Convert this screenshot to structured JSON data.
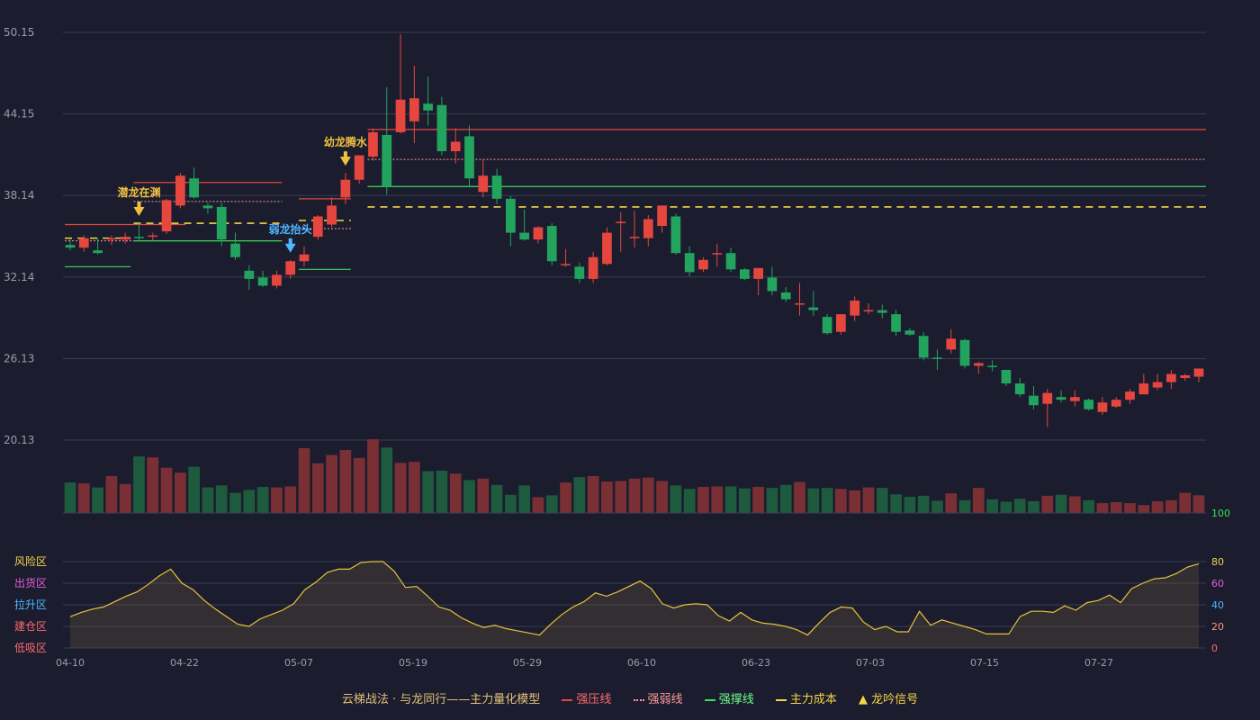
{
  "colors": {
    "background": "#1b1c2e",
    "up": "#e5473f",
    "down": "#22a45e",
    "pressure": "#e5473f",
    "weak": "#ff9a9a",
    "support": "#3ddc5a",
    "cost": "#f5d547",
    "osc_line": "#e8c23a"
  },
  "chart_data": {
    "type": "candlestick",
    "x_ticks": [
      "04-10",
      "04-22",
      "05-07",
      "05-19",
      "05-29",
      "06-10",
      "06-23",
      "07-03",
      "07-15",
      "07-27"
    ],
    "y_ticks": [
      "50.15",
      "44.15",
      "38.14",
      "32.14",
      "26.13",
      "20.13"
    ],
    "ylim": [
      20.13,
      50.15
    ],
    "candles": [
      [
        34.5,
        34.9,
        34.1,
        34.3
      ],
      [
        34.3,
        35.2,
        34.0,
        35.0
      ],
      [
        34.1,
        35.0,
        33.8,
        33.9
      ],
      [
        34.9,
        35.2,
        34.5,
        35.0
      ],
      [
        34.9,
        35.4,
        34.6,
        35.1
      ],
      [
        35.1,
        36.1,
        34.8,
        35.0
      ],
      [
        35.1,
        35.4,
        34.8,
        35.2
      ],
      [
        35.5,
        37.9,
        35.3,
        37.8
      ],
      [
        37.4,
        39.8,
        37.2,
        39.6
      ],
      [
        39.4,
        40.2,
        37.9,
        38.0
      ],
      [
        37.4,
        37.6,
        36.8,
        37.2
      ],
      [
        37.3,
        37.6,
        34.4,
        34.9
      ],
      [
        34.6,
        35.4,
        33.4,
        33.6
      ],
      [
        32.6,
        33.0,
        31.2,
        32.0
      ],
      [
        32.1,
        32.6,
        31.4,
        31.5
      ],
      [
        31.5,
        32.6,
        31.3,
        32.3
      ],
      [
        32.3,
        33.4,
        32.0,
        33.3
      ],
      [
        33.3,
        34.4,
        32.9,
        33.8
      ],
      [
        35.1,
        36.7,
        34.9,
        36.6
      ],
      [
        36.0,
        38.0,
        35.8,
        37.4
      ],
      [
        38.0,
        39.8,
        37.5,
        39.3
      ],
      [
        39.3,
        40.7,
        39.0,
        41.1
      ],
      [
        41.0,
        43.1,
        40.7,
        42.8
      ],
      [
        42.6,
        46.1,
        38.2,
        38.8
      ],
      [
        42.8,
        50.0,
        42.7,
        45.2
      ],
      [
        43.6,
        47.7,
        42.0,
        45.3
      ],
      [
        44.9,
        46.9,
        43.3,
        44.4
      ],
      [
        44.8,
        45.4,
        41.1,
        41.4
      ],
      [
        41.4,
        43.1,
        40.5,
        42.1
      ],
      [
        42.5,
        43.3,
        38.8,
        39.4
      ],
      [
        38.4,
        40.8,
        38.0,
        39.6
      ],
      [
        39.6,
        40.1,
        37.5,
        37.9
      ],
      [
        37.9,
        38.1,
        34.4,
        35.4
      ],
      [
        35.4,
        37.1,
        34.8,
        34.9
      ],
      [
        34.9,
        35.9,
        34.6,
        35.8
      ],
      [
        35.9,
        36.1,
        33.0,
        33.3
      ],
      [
        33.0,
        34.2,
        32.9,
        33.1
      ],
      [
        32.9,
        33.2,
        31.7,
        32.0
      ],
      [
        32.0,
        34.0,
        31.7,
        33.6
      ],
      [
        33.1,
        35.8,
        33.0,
        35.4
      ],
      [
        36.2,
        36.9,
        34.0,
        36.2
      ],
      [
        35.0,
        37.0,
        34.3,
        35.1
      ],
      [
        35.0,
        36.7,
        34.4,
        36.4
      ],
      [
        35.9,
        37.4,
        35.4,
        37.4
      ],
      [
        36.6,
        36.8,
        33.8,
        33.9
      ],
      [
        33.9,
        34.4,
        32.2,
        32.5
      ],
      [
        32.7,
        33.6,
        32.5,
        33.4
      ],
      [
        33.8,
        34.6,
        32.9,
        33.9
      ],
      [
        33.9,
        34.3,
        32.5,
        32.7
      ],
      [
        32.7,
        32.8,
        31.9,
        32.0
      ],
      [
        32.0,
        32.8,
        30.8,
        32.8
      ],
      [
        32.1,
        32.9,
        30.8,
        31.1
      ],
      [
        31.0,
        31.4,
        30.3,
        30.5
      ],
      [
        30.1,
        31.7,
        29.3,
        30.2
      ],
      [
        29.9,
        31.1,
        29.3,
        29.7
      ],
      [
        29.2,
        29.4,
        27.9,
        28.0
      ],
      [
        28.1,
        29.4,
        27.9,
        29.4
      ],
      [
        29.3,
        30.7,
        28.9,
        30.4
      ],
      [
        29.7,
        30.2,
        29.4,
        29.7
      ],
      [
        29.7,
        30.1,
        29.1,
        29.5
      ],
      [
        29.4,
        29.7,
        27.8,
        28.1
      ],
      [
        28.2,
        28.4,
        27.8,
        27.9
      ],
      [
        27.8,
        28.1,
        26.0,
        26.2
      ],
      [
        26.2,
        26.8,
        25.3,
        26.1
      ],
      [
        26.8,
        28.3,
        26.5,
        27.6
      ],
      [
        27.5,
        27.6,
        25.4,
        25.6
      ],
      [
        25.6,
        25.9,
        25.0,
        25.8
      ],
      [
        25.6,
        26.0,
        25.2,
        25.5
      ],
      [
        25.3,
        25.3,
        24.1,
        24.3
      ],
      [
        24.3,
        24.7,
        23.3,
        23.5
      ],
      [
        23.4,
        24.1,
        22.4,
        22.7
      ],
      [
        22.8,
        23.9,
        21.1,
        23.6
      ],
      [
        23.3,
        23.8,
        22.9,
        23.1
      ],
      [
        23.0,
        23.8,
        22.6,
        23.3
      ],
      [
        23.1,
        23.2,
        22.3,
        22.4
      ],
      [
        22.2,
        23.3,
        22.0,
        22.9
      ],
      [
        22.6,
        23.3,
        22.5,
        23.1
      ],
      [
        23.1,
        23.9,
        22.8,
        23.7
      ],
      [
        23.5,
        25.0,
        23.5,
        24.3
      ],
      [
        24.0,
        25.0,
        23.8,
        24.4
      ],
      [
        24.4,
        25.3,
        23.9,
        25.0
      ],
      [
        24.7,
        25.0,
        24.5,
        24.9
      ],
      [
        24.8,
        25.4,
        24.4,
        25.4
      ]
    ],
    "volume": [
      62,
      60,
      52,
      75,
      59,
      115,
      113,
      92,
      82,
      94,
      52,
      56,
      41,
      47,
      53,
      52,
      54,
      132,
      101,
      118,
      128,
      112,
      150,
      133,
      102,
      104,
      85,
      86,
      80,
      67,
      70,
      57,
      37,
      56,
      32,
      36,
      62,
      73,
      75,
      64,
      65,
      70,
      72,
      65,
      56,
      49,
      53,
      54,
      54,
      50,
      53,
      51,
      57,
      63,
      50,
      51,
      49,
      46,
      52,
      51,
      38,
      33,
      35,
      25,
      40,
      26,
      51,
      28,
      23,
      29,
      24,
      35,
      37,
      34,
      26,
      20,
      22,
      20,
      16,
      24,
      26,
      41,
      36,
      36,
      34,
      32
    ],
    "vol_max": 150,
    "oscillator": {
      "values": [
        29,
        33,
        36,
        38,
        43,
        48,
        52,
        59,
        67,
        73,
        60,
        54,
        44,
        36,
        29,
        22,
        20,
        27,
        31,
        35,
        41,
        54,
        61,
        70,
        73,
        73,
        79,
        80,
        80,
        71,
        56,
        57,
        48,
        38,
        35,
        28,
        23,
        19,
        21,
        18,
        16,
        14,
        12,
        22,
        31,
        38,
        43,
        51,
        48,
        52,
        57,
        62,
        55,
        41,
        37,
        40,
        41,
        40,
        30,
        25,
        33,
        26,
        23,
        22,
        20,
        17,
        12,
        23,
        33,
        38,
        37,
        24,
        17,
        20,
        15,
        15,
        34,
        21,
        26,
        23,
        20,
        17,
        13,
        13,
        13,
        29,
        34,
        34,
        33,
        39,
        35,
        42,
        44,
        49,
        42,
        55,
        60,
        64,
        65,
        69,
        75,
        78
      ],
      "ylim": [
        0,
        100
      ],
      "right_ticks": [
        "100",
        "80",
        "60",
        "40",
        "20",
        "0"
      ],
      "zones": [
        "风险区",
        "出货区",
        "拉升区",
        "建仓区",
        "低吸区"
      ]
    },
    "lines": {
      "pressure": [
        {
          "x1": 0,
          "x2": 8,
          "y": 36.0
        },
        {
          "x1": 5,
          "x2": 15,
          "y": 39.1
        },
        {
          "x1": 17,
          "x2": 20,
          "y": 37.9
        },
        {
          "x1": 22,
          "x2": 83,
          "y": 43.0
        }
      ],
      "weak": [
        {
          "x1": 0,
          "x2": 5,
          "y": 34.8
        },
        {
          "x1": 5,
          "x2": 15,
          "y": 37.7
        },
        {
          "x1": 17,
          "x2": 20,
          "y": 35.7
        },
        {
          "x1": 22,
          "x2": 83,
          "y": 40.8
        }
      ],
      "support": [
        {
          "x1": 0,
          "x2": 4,
          "y": 32.9
        },
        {
          "x1": 5,
          "x2": 15,
          "y": 34.8
        },
        {
          "x1": 17,
          "x2": 20,
          "y": 32.7
        },
        {
          "x1": 22,
          "x2": 83,
          "y": 38.8
        }
      ],
      "cost": [
        {
          "x1": 0,
          "x2": 4,
          "y": 35.0
        },
        {
          "x1": 5,
          "x2": 15,
          "y": 36.1
        },
        {
          "x1": 17,
          "x2": 20,
          "y": 36.3
        },
        {
          "x1": 22,
          "x2": 83,
          "y": 37.3
        }
      ]
    },
    "signals": [
      {
        "index": 5,
        "label": "潜龙在渊",
        "color": "#f0c040"
      },
      {
        "index": 16,
        "label": "弱龙抬头",
        "color": "#4fb6ff"
      },
      {
        "index": 20,
        "label": "幼龙腾水",
        "color": "#f0c040"
      }
    ]
  },
  "legend": {
    "title": "云梯战法 · 与龙同行——主力量化模型",
    "pressure": "强压线",
    "weak": "强弱线",
    "support": "强撑线",
    "cost": "主力成本",
    "signal": "龙吟信号"
  }
}
